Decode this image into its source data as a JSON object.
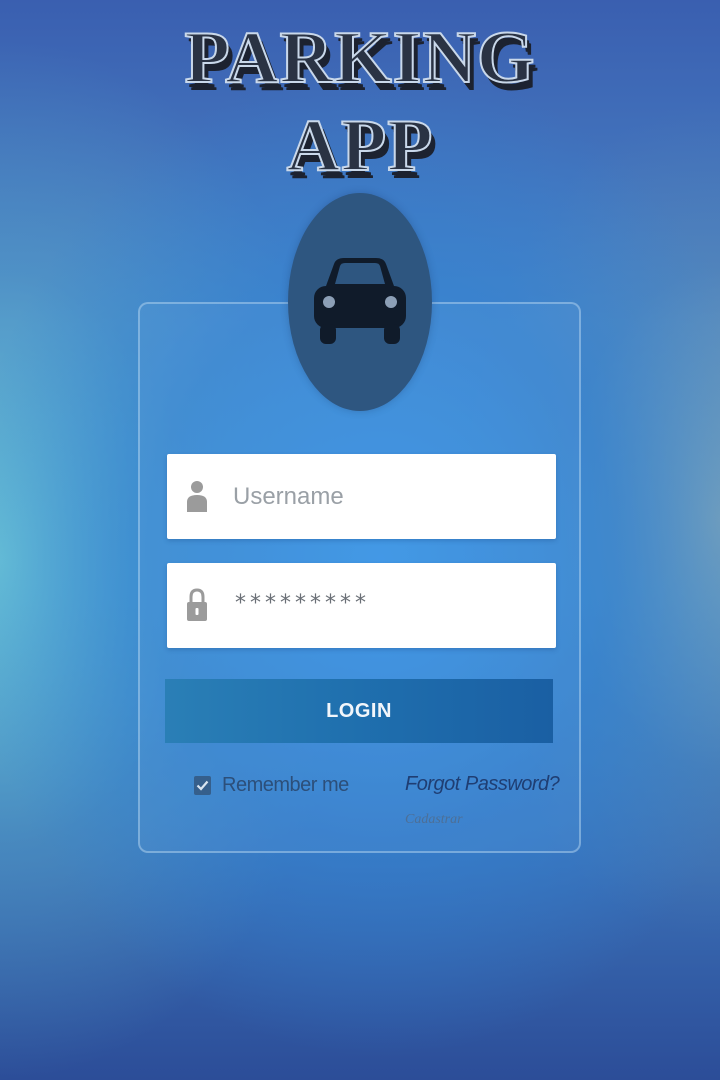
{
  "app": {
    "title_line1": "PARKING",
    "title_line2": "APP"
  },
  "colors": {
    "avatar_circle": "#2e5680",
    "login_button": "#1f6fae",
    "link": "#1f3e73"
  },
  "icons": {
    "avatar": "car-icon",
    "username": "user-icon",
    "password": "lock-icon",
    "remember": "checkmark-icon"
  },
  "login_form": {
    "username": {
      "placeholder": "Username",
      "value": ""
    },
    "password": {
      "value": "*********"
    },
    "login_label": "LOGIN",
    "remember_label": "Remember me",
    "remember_checked": true,
    "forgot_label": "Forgot Password?",
    "register_label": "Cadastrar"
  }
}
